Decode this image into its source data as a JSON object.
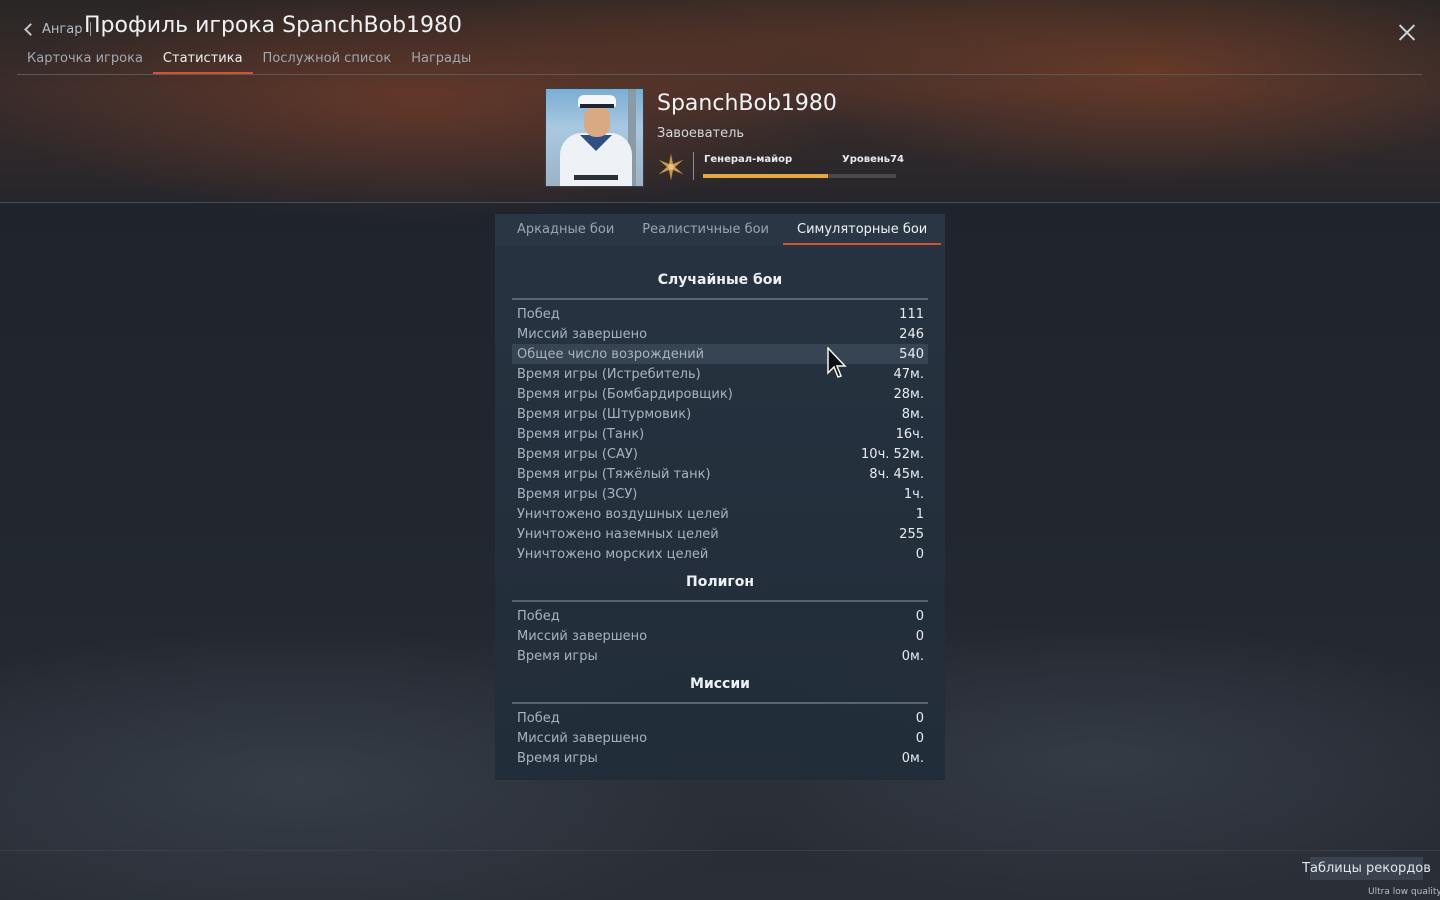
{
  "header": {
    "back_label": "Ангар",
    "title": "Профиль игрока SpanchBob1980",
    "tabs": [
      {
        "label": "Карточка игрока"
      },
      {
        "label": "Статистика"
      },
      {
        "label": "Послужной список"
      },
      {
        "label": "Награды"
      }
    ],
    "active_tab": 1
  },
  "player": {
    "nickname": "SpanchBob1980",
    "title": "Завоеватель",
    "rank": "Генерал-майор",
    "level": "Уровень74",
    "level_progress": 0.65
  },
  "mode_tabs": [
    {
      "label": "Аркадные бои"
    },
    {
      "label": "Реалистичные бои"
    },
    {
      "label": "Симуляторные бои"
    }
  ],
  "active_mode": 2,
  "sections": [
    {
      "title": "Случайные бои",
      "rows": [
        {
          "label": "Побед",
          "value": "111"
        },
        {
          "label": "Миссий завершено",
          "value": "246"
        },
        {
          "label": "Общее число возрождений",
          "value": "540"
        },
        {
          "label": "Время игры (Истребитель)",
          "value": "47м."
        },
        {
          "label": "Время игры (Бомбардировщик)",
          "value": "28м."
        },
        {
          "label": "Время игры (Штурмовик)",
          "value": "8м."
        },
        {
          "label": "Время игры (Танк)",
          "value": "16ч."
        },
        {
          "label": "Время игры (САУ)",
          "value": "10ч. 52м."
        },
        {
          "label": "Время игры (Тяжёлый танк)",
          "value": "8ч. 45м."
        },
        {
          "label": "Время игры (ЗСУ)",
          "value": "1ч."
        },
        {
          "label": "Уничтожено воздушных целей",
          "value": "1"
        },
        {
          "label": "Уничтожено наземных целей",
          "value": "255"
        },
        {
          "label": "Уничтожено морских целей",
          "value": "0"
        }
      ]
    },
    {
      "title": "Полигон",
      "rows": [
        {
          "label": "Побед",
          "value": "0"
        },
        {
          "label": "Миссий завершено",
          "value": "0"
        },
        {
          "label": "Время игры",
          "value": "0м."
        }
      ]
    },
    {
      "title": "Миссии",
      "rows": [
        {
          "label": "Побед",
          "value": "0"
        },
        {
          "label": "Миссий завершено",
          "value": "0"
        },
        {
          "label": "Время игры",
          "value": "0м."
        }
      ]
    }
  ],
  "footer": {
    "records_button": "Таблицы рекордов",
    "quality_label": "Ultra low quality"
  },
  "colors": {
    "accent": "#d5512f",
    "progress": "#e3a844"
  }
}
